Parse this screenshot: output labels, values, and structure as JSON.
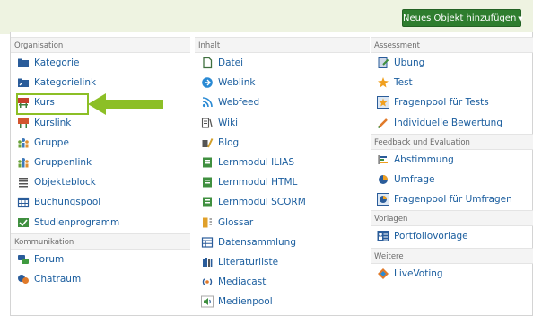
{
  "toolbar": {
    "add_button_label": "Neues Objekt hinzufügen"
  },
  "columns": [
    {
      "sections": [
        {
          "header": "Organisation",
          "items": [
            {
              "label": "Kategorie",
              "icon": "folder-icon"
            },
            {
              "label": "Kategorielink",
              "icon": "folder-link-icon"
            },
            {
              "label": "Kurs",
              "icon": "course-icon"
            },
            {
              "label": "Kurslink",
              "icon": "course-link-icon"
            },
            {
              "label": "Gruppe",
              "icon": "group-icon"
            },
            {
              "label": "Gruppenlink",
              "icon": "group-link-icon"
            },
            {
              "label": "Objekteblock",
              "icon": "list-icon"
            },
            {
              "label": "Buchungspool",
              "icon": "calendar-icon"
            },
            {
              "label": "Studienprogramm",
              "icon": "study-program-icon"
            }
          ]
        },
        {
          "header": "Kommunikation",
          "items": [
            {
              "label": "Forum",
              "icon": "forum-icon"
            },
            {
              "label": "Chatraum",
              "icon": "chat-icon"
            }
          ]
        }
      ]
    },
    {
      "sections": [
        {
          "header": "Inhalt",
          "items": [
            {
              "label": "Datei",
              "icon": "file-icon"
            },
            {
              "label": "Weblink",
              "icon": "weblink-icon"
            },
            {
              "label": "Webfeed",
              "icon": "rss-icon"
            },
            {
              "label": "Wiki",
              "icon": "wiki-icon"
            },
            {
              "label": "Blog",
              "icon": "blog-icon"
            },
            {
              "label": "Lernmodul ILIAS",
              "icon": "learning-module-icon"
            },
            {
              "label": "Lernmodul HTML",
              "icon": "learning-module-icon"
            },
            {
              "label": "Lernmodul SCORM",
              "icon": "learning-module-icon"
            },
            {
              "label": "Glossar",
              "icon": "glossary-icon"
            },
            {
              "label": "Datensammlung",
              "icon": "table-icon"
            },
            {
              "label": "Literaturliste",
              "icon": "books-icon"
            },
            {
              "label": "Mediacast",
              "icon": "podcast-icon"
            },
            {
              "label": "Medienpool",
              "icon": "speaker-icon"
            }
          ]
        }
      ]
    },
    {
      "sections": [
        {
          "header": "Assessment",
          "items": [
            {
              "label": "Übung",
              "icon": "exercise-icon"
            },
            {
              "label": "Test",
              "icon": "test-icon"
            },
            {
              "label": "Fragenpool für Tests",
              "icon": "question-pool-icon"
            },
            {
              "label": "Individuelle Bewertung",
              "icon": "pencil-icon"
            }
          ]
        },
        {
          "header": "Feedback und Evaluation",
          "items": [
            {
              "label": "Abstimmung",
              "icon": "poll-icon"
            },
            {
              "label": "Umfrage",
              "icon": "survey-icon"
            },
            {
              "label": "Fragenpool für Umfragen",
              "icon": "survey-pool-icon"
            }
          ]
        },
        {
          "header": "Vorlagen",
          "items": [
            {
              "label": "Portfoliovorlage",
              "icon": "portfolio-icon"
            }
          ]
        },
        {
          "header": "Weitere",
          "items": [
            {
              "label": "LiveVoting",
              "icon": "livevoting-icon"
            }
          ]
        }
      ]
    }
  ],
  "colors": {
    "accent": "#2e7d2e",
    "link": "#1a5d9e",
    "highlight": "#8cbf26"
  }
}
